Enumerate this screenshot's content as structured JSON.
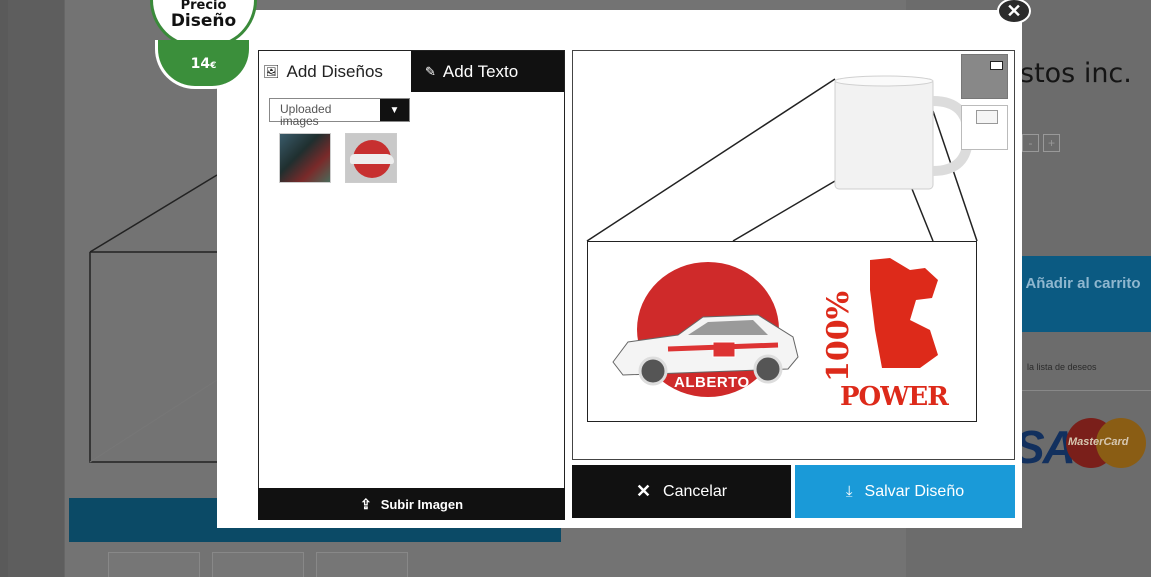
{
  "background": {
    "title_fragment": "stos inc.",
    "qty_minus": "-",
    "qty_plus": "+",
    "cart_button": "Añadir al carrito",
    "wishlist_link": "la lista de deseos",
    "payment_visa": "SA",
    "payment_mastercard": "MasterCard"
  },
  "price_badge": {
    "label_line1": "Precio",
    "label_line2": "Diseño",
    "value": "14",
    "currency": "€"
  },
  "tabs": {
    "designs": "Add Diseños",
    "text": "Add Texto",
    "designs_icon": "image-icon",
    "text_icon": "pen-icon"
  },
  "designs_panel": {
    "source_select": "Uploaded images",
    "upload_button": "Subir Imagen",
    "upload_icon": "upload-icon"
  },
  "design_preview": {
    "left_graphic_text": "ALBERTO",
    "right_graphic_text_pct": "100%",
    "right_graphic_text": "POWER"
  },
  "actions": {
    "cancel": "Cancelar",
    "save": "Salvar Diseño",
    "cancel_icon": "close-icon",
    "save_icon": "download-icon"
  },
  "colors": {
    "price_green": "#3b8f3b",
    "save_blue": "#1a9ad8",
    "design_red": "#cf2a2a"
  }
}
